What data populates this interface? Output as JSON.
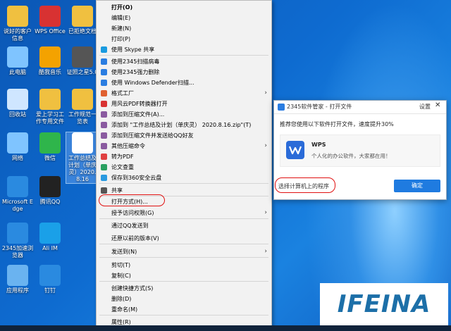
{
  "desktop_icons": [
    {
      "label": "说好的客户信息",
      "color": "#f0c040"
    },
    {
      "label": "WPS Office",
      "color": "#d83232"
    },
    {
      "label": "已拒绝文档",
      "color": "#f0c040"
    },
    {
      "label": "此电脑",
      "color": "#7fc4ff"
    },
    {
      "label": "酷我音乐",
      "color": "#f4a200"
    },
    {
      "label": "证照之星5.0",
      "color": "#555"
    },
    {
      "label": "回收站",
      "color": "#cfe6ff"
    },
    {
      "label": "爱上学习工作专用文件",
      "color": "#f0c040"
    },
    {
      "label": "工作规范一览表",
      "color": "#f0c040"
    },
    {
      "label": "网络",
      "color": "#7fc4ff"
    },
    {
      "label": "微信",
      "color": "#2fb54b"
    },
    {
      "label": "工作总结及计划（单庆灵）2020.8.16",
      "color": "#ffffff"
    },
    {
      "label": "Microsoft Edge",
      "color": "#2a8ae0"
    },
    {
      "label": "腾讯QQ",
      "color": "#222"
    },
    {
      "label": "2345加速浏览器",
      "color": "#2a8ae0"
    },
    {
      "label": "Ali IM",
      "color": "#1aa0e8"
    },
    {
      "label": "应用程序",
      "color": "#6ab3f0"
    },
    {
      "label": "钉钉",
      "color": "#2a8ae0"
    }
  ],
  "context_menu": {
    "items": [
      {
        "label": "打开(O)",
        "bold": true,
        "icon": "",
        "arrow": false
      },
      {
        "label": "编辑(E)",
        "icon": "",
        "arrow": false
      },
      {
        "label": "新建(N)",
        "icon": "",
        "arrow": false
      },
      {
        "label": "打印(P)",
        "icon": "",
        "arrow": false
      },
      {
        "label": "使用 Skype 共享",
        "icon": "skype-icon",
        "arrow": false
      },
      {
        "label": "使用2345扫描病毒",
        "icon": "shield-icon",
        "arrow": false
      },
      {
        "label": "使用2345强力删除",
        "icon": "shield-icon",
        "arrow": false
      },
      {
        "label": "使用 Windows Defender扫描...",
        "icon": "defender-icon",
        "arrow": false
      },
      {
        "label": "格式工厂",
        "icon": "format-factory-icon",
        "arrow": true
      },
      {
        "label": "用风云PDF转换器打开",
        "icon": "pdf-converter-icon",
        "arrow": false
      },
      {
        "label": "添加到压缩文件(A)...",
        "icon": "archive-icon",
        "arrow": false
      },
      {
        "label": "添加到 \"工作总结及计划（单庆灵） 2020.8.16.zip\"(T)",
        "icon": "archive-icon",
        "arrow": false
      },
      {
        "label": "添加到压缩文件并发送给QQ好友",
        "icon": "archive-icon",
        "arrow": false
      },
      {
        "label": "其他压缩命令",
        "icon": "archive-icon",
        "arrow": true
      },
      {
        "label": "转为PDF",
        "icon": "pdf-icon",
        "arrow": false
      },
      {
        "label": "论文查重",
        "icon": "paper-check-icon",
        "arrow": false
      },
      {
        "label": "保存到360安全云盘",
        "icon": "cloud-icon",
        "arrow": false
      },
      {
        "label": "共享",
        "icon": "share-icon",
        "arrow": false
      },
      {
        "label": "打开方式(H)...",
        "icon": "",
        "arrow": false
      },
      {
        "label": "授予访问权限(G)",
        "icon": "",
        "arrow": true
      },
      {
        "label": "通过QQ发送到",
        "icon": "",
        "arrow": false
      },
      {
        "label": "还原以前的版本(V)",
        "icon": "",
        "arrow": false
      },
      {
        "label": "发送到(N)",
        "icon": "",
        "arrow": true
      },
      {
        "label": "剪切(T)",
        "icon": "",
        "arrow": false
      },
      {
        "label": "复制(C)",
        "icon": "",
        "arrow": false
      },
      {
        "label": "创建快捷方式(S)",
        "icon": "",
        "arrow": false
      },
      {
        "label": "删除(D)",
        "icon": "",
        "arrow": false
      },
      {
        "label": "重命名(M)",
        "icon": "",
        "arrow": false
      },
      {
        "label": "属性(R)",
        "icon": "",
        "arrow": false
      }
    ]
  },
  "dialog": {
    "title": "2345软件管家 - 打开文件",
    "settings_label": "设置",
    "close_label": "✕",
    "message": "推荐您使用以下软件打开文件，速度提升30%",
    "app_name": "WPS",
    "app_desc": "个人化的办公软件，大家都在用！",
    "choose_label": "选择计算机上的程序",
    "ok_label": "确定"
  },
  "watermark": {
    "text": "IFEINA"
  }
}
